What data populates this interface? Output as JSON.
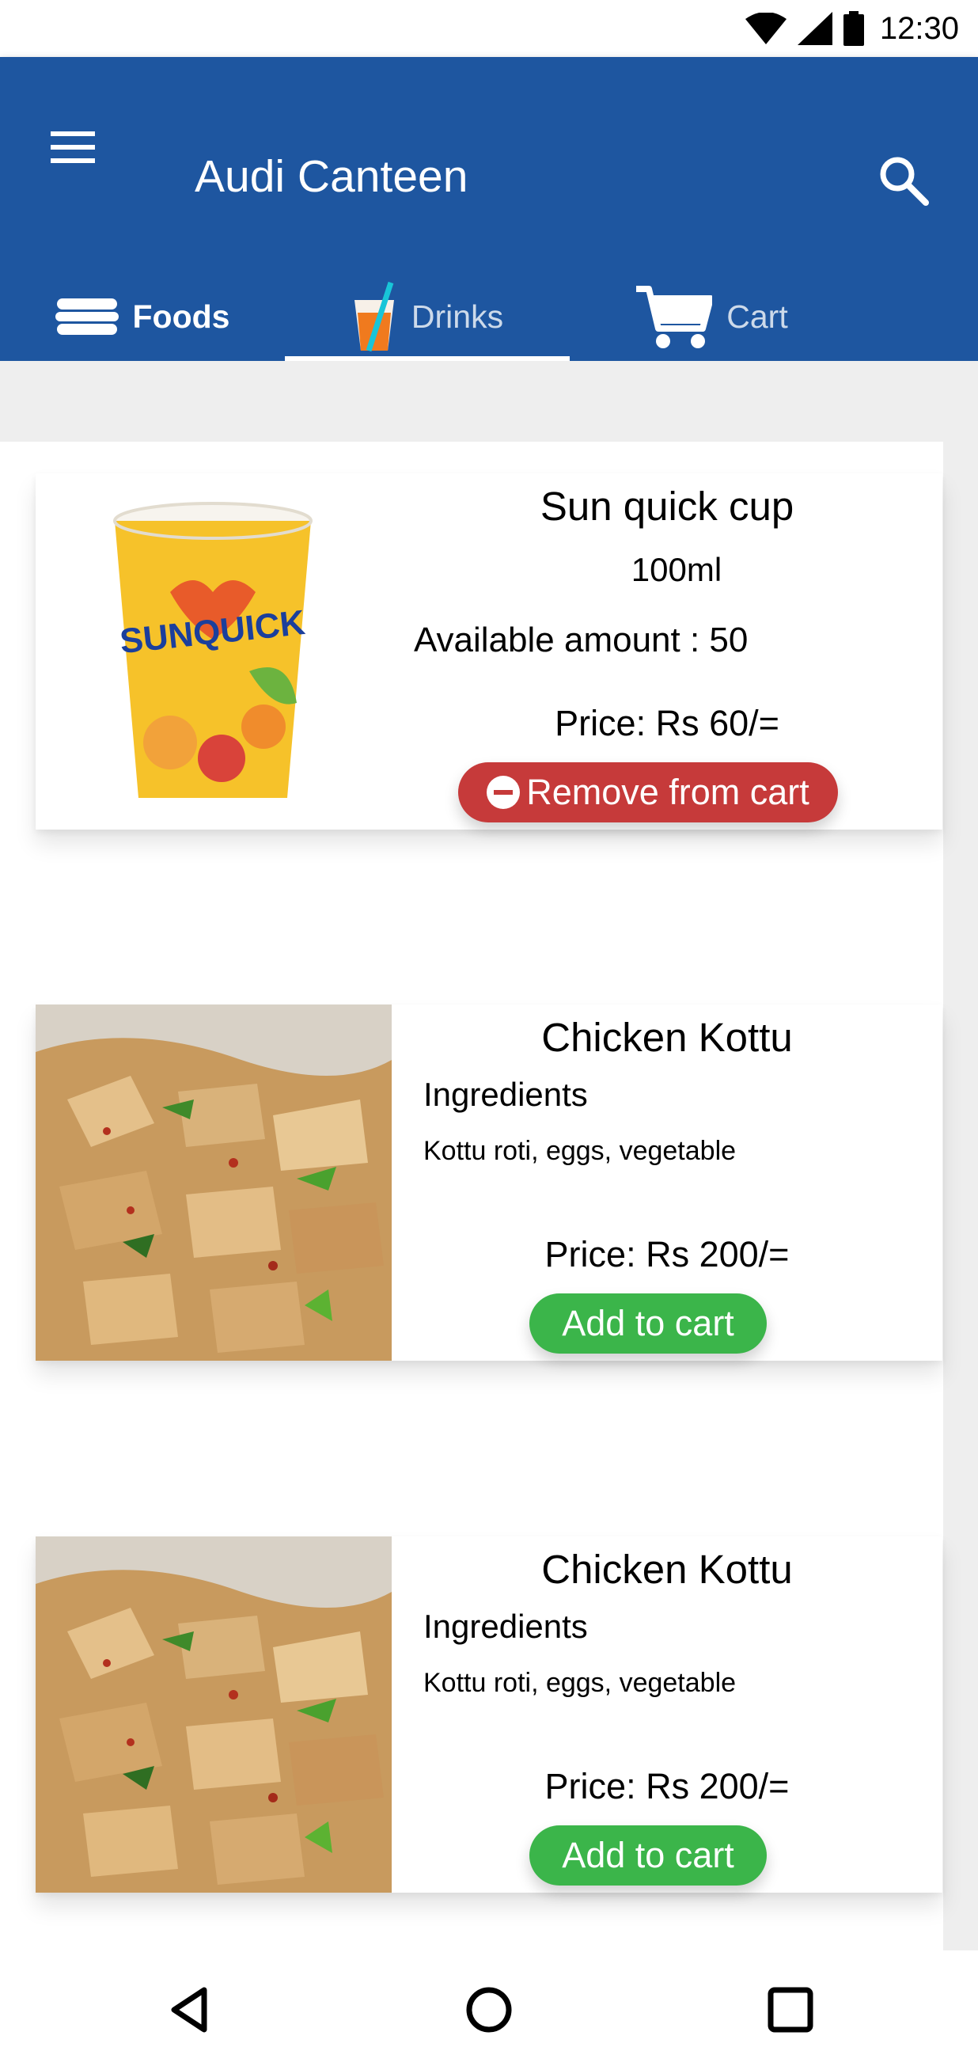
{
  "status_bar": {
    "time": "12:30",
    "icons": [
      "wifi-icon",
      "cellular-signal-icon",
      "battery-icon"
    ]
  },
  "app_bar": {
    "title": "Audi Canteen",
    "menu_icon": "menu-icon",
    "search_icon": "search-icon",
    "color": "#1e56a0"
  },
  "tabs": [
    {
      "label": "Foods",
      "icon": "food-icon",
      "active": false
    },
    {
      "label": "Drinks",
      "icon": "drink-icon",
      "active": true
    },
    {
      "label": "Cart",
      "icon": "cart-icon",
      "active": false
    }
  ],
  "items": [
    {
      "title": "Sun quick cup",
      "size": "100ml",
      "available": "Available amount : 50",
      "price": "Price: Rs 60/=",
      "button": "Remove from cart",
      "image_text": "SUNQUICK"
    },
    {
      "title": "Chicken Kottu",
      "ingredients_label": "Ingredients",
      "ingredients": "Kottu roti, eggs, vegetable",
      "price": "Price: Rs 200/=",
      "button": "Add to cart"
    },
    {
      "title": "Chicken Kottu",
      "ingredients_label": "Ingredients",
      "ingredients": "Kottu roti, eggs, vegetable",
      "price": "Price: Rs 200/=",
      "button": "Add to cart"
    }
  ],
  "colors": {
    "remove_button": "#c63a3a",
    "add_button": "#3bb54a"
  },
  "nav_bar": {
    "icons": [
      "back-icon",
      "home-icon",
      "recents-icon"
    ]
  }
}
